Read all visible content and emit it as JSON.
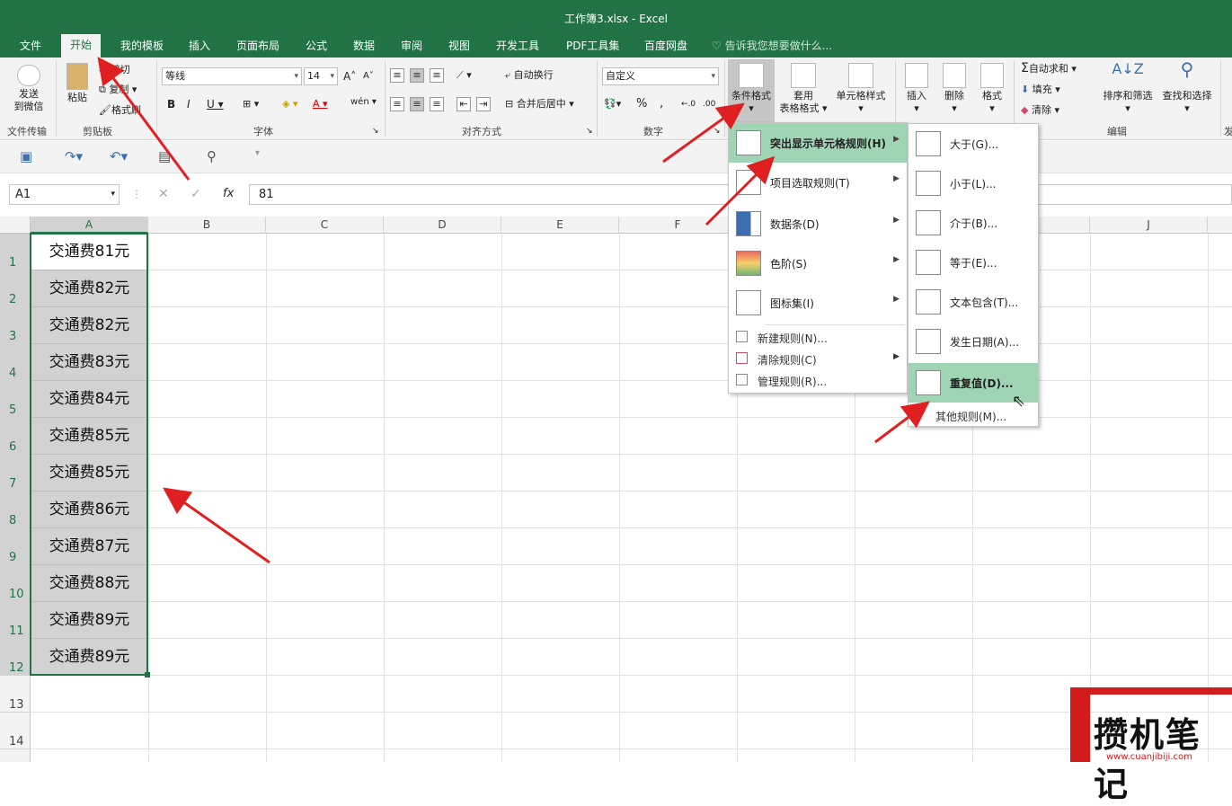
{
  "window_title": "工作簿3.xlsx - Excel",
  "tabs": [
    "文件",
    "开始",
    "我的模板",
    "插入",
    "页面布局",
    "公式",
    "数据",
    "审阅",
    "视图",
    "开发工具",
    "PDF工具集",
    "百度网盘"
  ],
  "tell_me": "告诉我您想要做什么...",
  "ribbon": {
    "send_wechat": "发送\n到微信",
    "group_file_transfer": "文件传输",
    "paste": "粘贴",
    "cut": "剪切",
    "copy": "复制",
    "format_painter": "格式刷",
    "group_clipboard": "剪贴板",
    "font_name": "等线",
    "font_size": "14",
    "group_font": "字体",
    "wrap_text": "自动换行",
    "merge_center": "合并后居中",
    "group_alignment": "对齐方式",
    "number_format": "自定义",
    "group_number": "数字",
    "conditional_format": "条件格式",
    "table_format": "套用\n表格格式",
    "cell_styles": "单元格样式",
    "insert": "插入",
    "delete": "删除",
    "format": "格式",
    "autosum": "自动求和",
    "fill": "填充",
    "clear": "清除",
    "sort_filter": "排序和筛选",
    "find_select": "查找和选择",
    "group_editing": "编辑",
    "group_cut_right": "发"
  },
  "formula_bar": {
    "name_box": "A1",
    "fx": "fx",
    "value": "81"
  },
  "columns": [
    "A",
    "B",
    "C",
    "D",
    "E",
    "F",
    "G",
    "H",
    "I",
    "J"
  ],
  "rows": [
    "1",
    "2",
    "3",
    "4",
    "5",
    "6",
    "7",
    "8",
    "9",
    "10",
    "11",
    "12",
    "13",
    "14"
  ],
  "cells": [
    "交通费81元",
    "交通费82元",
    "交通费82元",
    "交通费83元",
    "交通费84元",
    "交通费85元",
    "交通费85元",
    "交通费86元",
    "交通费87元",
    "交通费88元",
    "交通费89元",
    "交通费89元"
  ],
  "cf_menu": {
    "items": [
      "突出显示单元格规则(H)",
      "项目选取规则(T)",
      "数据条(D)",
      "色阶(S)",
      "图标集(I)"
    ],
    "small_items": [
      "新建规则(N)...",
      "清除规则(C)",
      "管理规则(R)..."
    ]
  },
  "sub_menu": {
    "items": [
      "大于(G)...",
      "小于(L)...",
      "介于(B)...",
      "等于(E)...",
      "文本包含(T)...",
      "发生日期(A)...",
      "重复值(D)..."
    ],
    "other": "其他规则(M)..."
  },
  "watermark": {
    "text": "攒机笔记",
    "url": "www.cuanjibiji.com"
  },
  "colors": {
    "excel_green": "#217346",
    "highlight": "#9fd5b4",
    "arrow": "#e02020"
  }
}
